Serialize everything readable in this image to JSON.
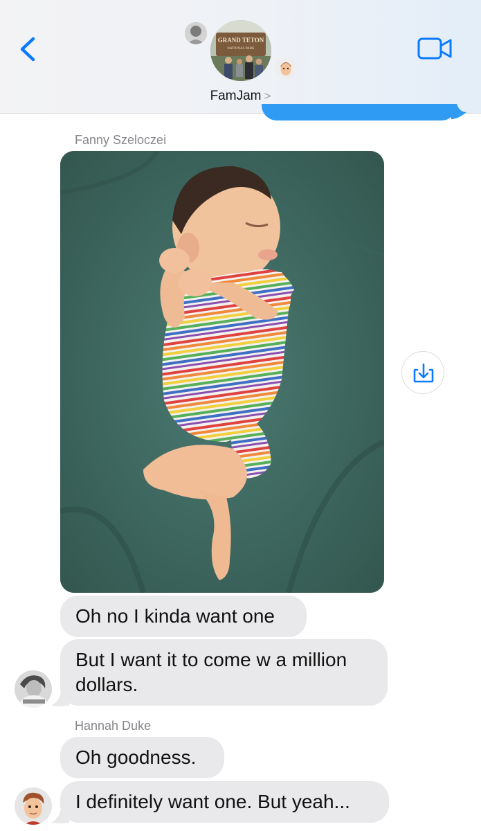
{
  "header": {
    "group_name": "FamJam",
    "chevron": ">",
    "group_photo_sign_line1": "GRAND TETON",
    "group_photo_sign_line2": "NATIONAL PARK",
    "accent_color": "#0a7aff"
  },
  "messages": {
    "sender1": "Fanny Szeloczei",
    "msg1": "Oh no I kinda want one",
    "msg2_line1": "But I want it to come w a million",
    "msg2_line2": "dollars.",
    "sender2": "Hannah Duke",
    "msg3": "Oh goodness.",
    "msg4": "I definitely want one. But yeah..."
  },
  "icons": {
    "back": "chevron-left-icon",
    "video": "video-camera-icon",
    "save": "download-icon"
  },
  "colors": {
    "bubble_gray": "#e9e9eb",
    "sent_blue": "#2f9bf2"
  }
}
